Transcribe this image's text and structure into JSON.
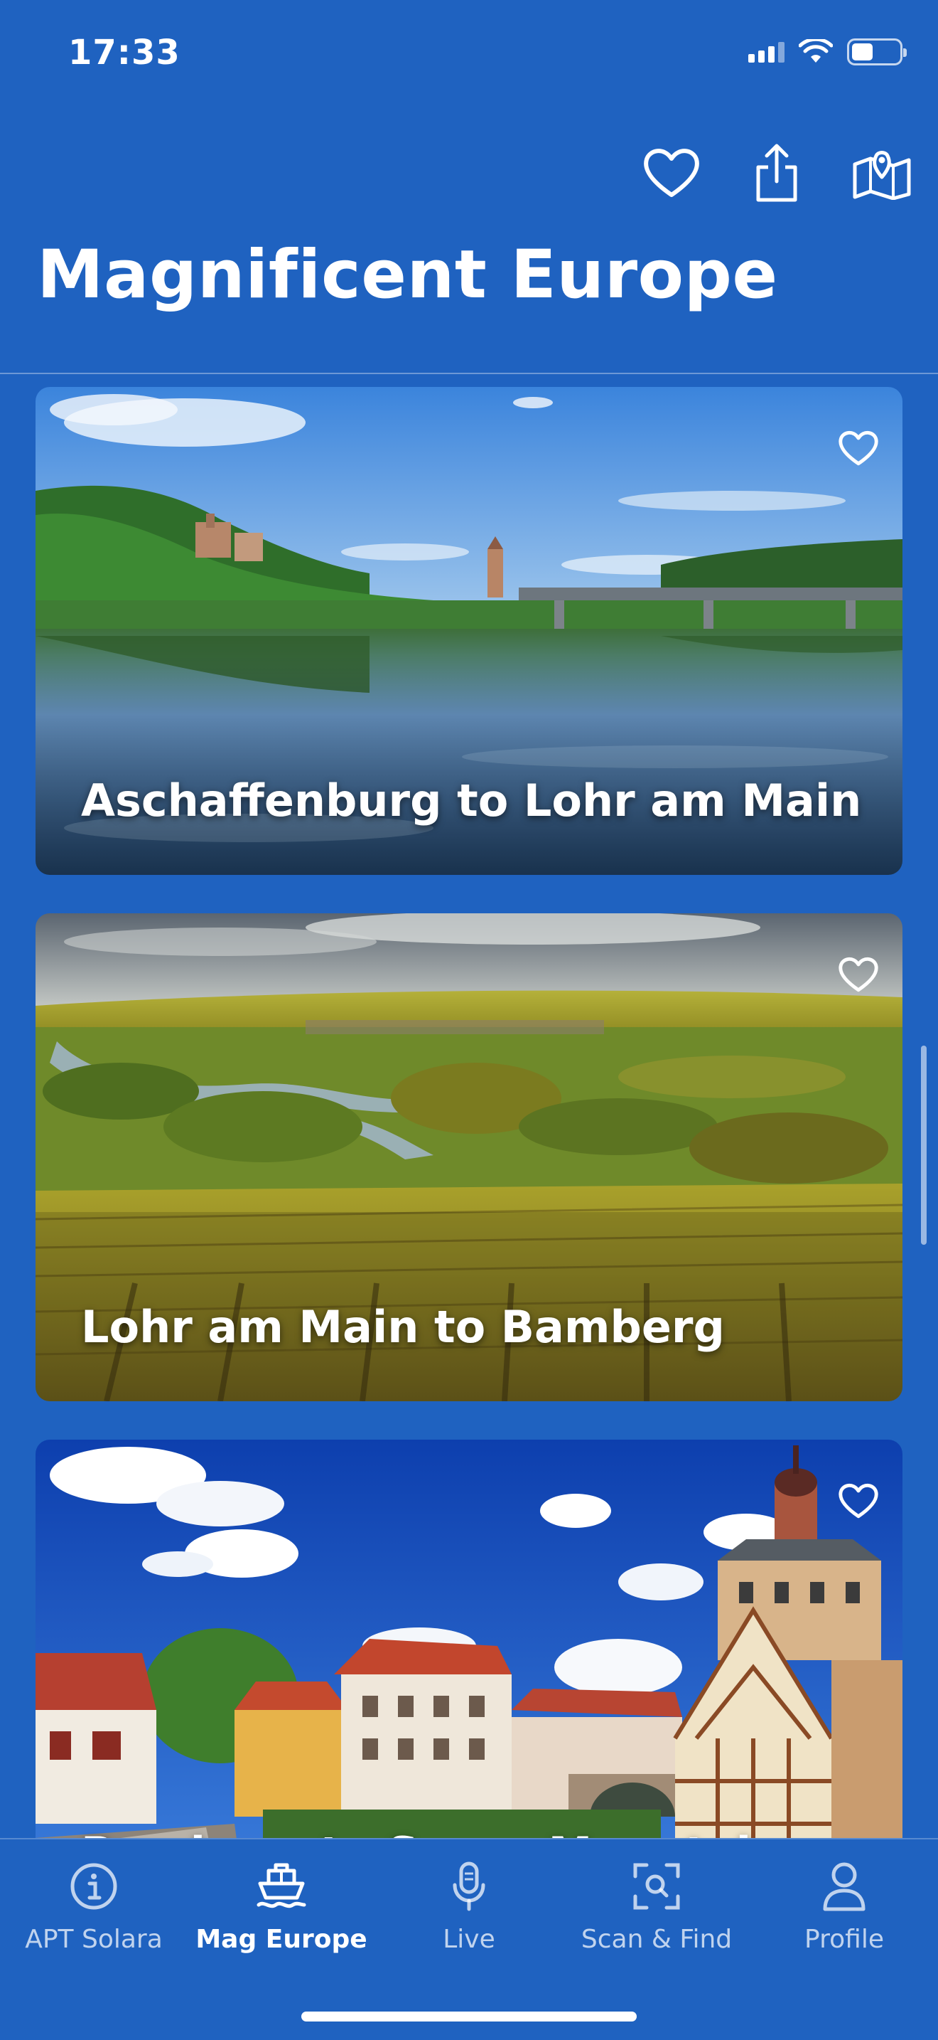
{
  "status_bar": {
    "time": "17:33"
  },
  "header": {
    "title": "Magnificent Europe",
    "actions": [
      {
        "icon": "heart-outline-icon"
      },
      {
        "icon": "share-icon"
      },
      {
        "icon": "map-icon"
      }
    ]
  },
  "cards": [
    {
      "title": "Aschaffenburg to Lohr am Main",
      "favorite": false
    },
    {
      "title": "Lohr am Main to Bamberg",
      "favorite": false
    },
    {
      "title": "Bamberg to Sugar Mountain",
      "favorite": false
    }
  ],
  "tab_bar": {
    "tabs": [
      {
        "label": "APT Solara",
        "icon": "info-circle-icon",
        "active": false
      },
      {
        "label": "Mag Europe",
        "icon": "ship-icon",
        "active": true
      },
      {
        "label": "Live",
        "icon": "microphone-icon",
        "active": false
      },
      {
        "label": "Scan & Find",
        "icon": "scan-icon",
        "active": false
      },
      {
        "label": "Profile",
        "icon": "person-icon",
        "active": false
      }
    ]
  },
  "colors": {
    "background": "#1f62c0",
    "text": "#ffffff"
  }
}
